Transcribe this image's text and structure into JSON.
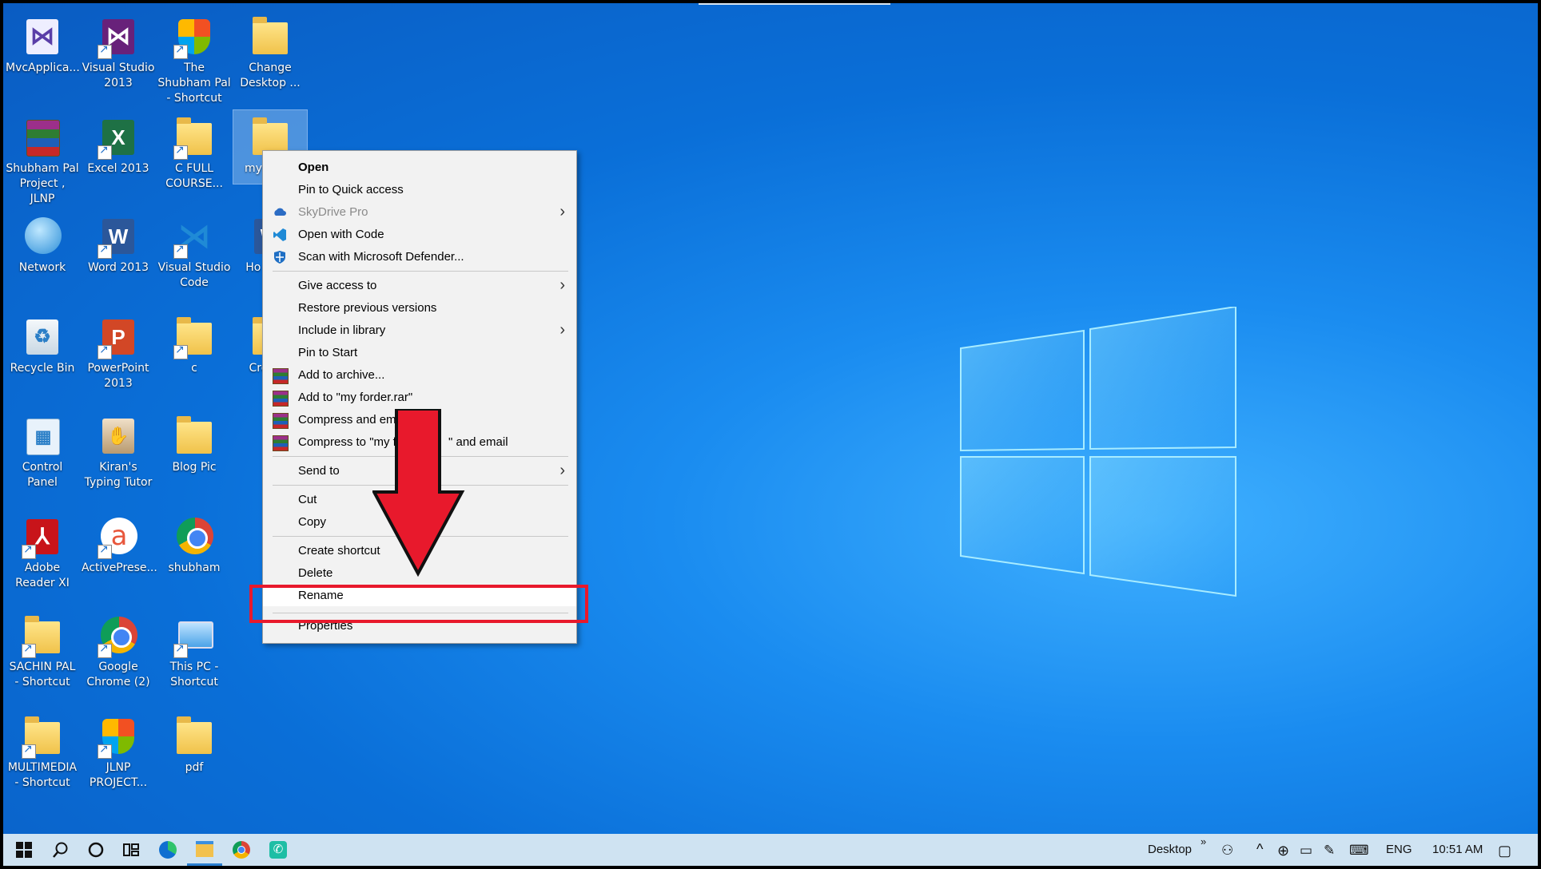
{
  "desktop": {
    "icons": [
      {
        "label": "MvcApplica...",
        "icon": "visual-studio-project-icon"
      },
      {
        "label": "Visual Studio 2013",
        "icon": "visual-studio-2013-icon"
      },
      {
        "label": "The Shubham Pal - Shortcut",
        "icon": "shield-shortcut-icon"
      },
      {
        "label": "Change Desktop ...",
        "icon": "folder-icon"
      },
      {
        "label": "Shubham Pal Project , JLNP",
        "icon": "winrar-archive-icon"
      },
      {
        "label": "Excel 2013",
        "icon": "excel-icon"
      },
      {
        "label": "C FULL COURSE...",
        "icon": "folder-icon"
      },
      {
        "label": "my",
        "icon": "folder-icon"
      },
      {
        "label": "Network",
        "icon": "network-icon"
      },
      {
        "label": "Word 2013",
        "icon": "word-icon"
      },
      {
        "label": "Visual Studio Code",
        "icon": "vscode-icon"
      },
      {
        "label": "Ho Creat",
        "icon": "word-doc-icon"
      },
      {
        "label": "Recycle Bin",
        "icon": "recycle-bin-icon"
      },
      {
        "label": "PowerPoint 2013",
        "icon": "powerpoint-icon"
      },
      {
        "label": "c",
        "icon": "folder-icon"
      },
      {
        "label": "Crea Fo",
        "icon": "folder-icon"
      },
      {
        "label": "Control Panel",
        "icon": "control-panel-icon"
      },
      {
        "label": "Kiran's Typing Tutor",
        "icon": "typing-tutor-icon"
      },
      {
        "label": "Blog Pic",
        "icon": "folder-icon"
      },
      {
        "label": "Adobe Reader XI",
        "icon": "adobe-reader-icon"
      },
      {
        "label": "ActivePrese...",
        "icon": "activepresenter-icon"
      },
      {
        "label": "shubham",
        "icon": "chrome-icon"
      },
      {
        "label": "SACHIN PAL - Shortcut",
        "icon": "folder-pdf-icon"
      },
      {
        "label": "Google Chrome (2)",
        "icon": "chrome-icon"
      },
      {
        "label": "This PC - Shortcut",
        "icon": "this-pc-icon"
      },
      {
        "label": "MULTIMEDIA - Shortcut",
        "icon": "folder-icon"
      },
      {
        "label": "JLNP PROJECT...",
        "icon": "shield-shortcut-icon"
      },
      {
        "label": "pdf",
        "icon": "folder-pdf-icon"
      }
    ]
  },
  "context_menu": {
    "items": [
      {
        "label": "Open",
        "bold": true
      },
      {
        "label": "Pin to Quick access"
      },
      {
        "label": "SkyDrive Pro",
        "disabled": true,
        "submenu": true,
        "icon": "cloud-icon"
      },
      {
        "label": "Open with Code",
        "icon": "vscode-icon"
      },
      {
        "label": "Scan with Microsoft Defender...",
        "icon": "defender-icon"
      },
      {
        "label": "Give access to",
        "submenu": true
      },
      {
        "label": "Restore previous versions"
      },
      {
        "label": "Include in library",
        "submenu": true
      },
      {
        "label": "Pin to Start"
      },
      {
        "label": "Add to archive...",
        "icon": "winrar-icon"
      },
      {
        "label": "Add to \"my forder.rar\"",
        "icon": "winrar-icon"
      },
      {
        "label": "Compress and ema",
        "icon": "winrar-icon"
      },
      {
        "label": "Compress to \"my f",
        "label_tail": "\" and email",
        "icon": "winrar-icon"
      },
      {
        "label": "Send to",
        "submenu": true
      },
      {
        "label": "Cut"
      },
      {
        "label": "Copy"
      },
      {
        "label": "Create shortcut"
      },
      {
        "label": "Delete"
      },
      {
        "label": "Rename",
        "highlighted": true
      },
      {
        "label": "Properties"
      }
    ]
  },
  "taskbar": {
    "apps": [
      "windows-start-icon",
      "search-icon",
      "cortana-icon",
      "task-view-icon",
      "edge-icon",
      "file-explorer-icon",
      "chrome-icon",
      "whatsapp-icon"
    ],
    "desktop_label": "Desktop",
    "chevron": "»",
    "language": "ENG",
    "time": "10:51 AM"
  },
  "colors": {
    "annotation_red": "#e8192c",
    "desktop_blue": "#0a6fd8",
    "taskbar": "#cfe3f2"
  }
}
